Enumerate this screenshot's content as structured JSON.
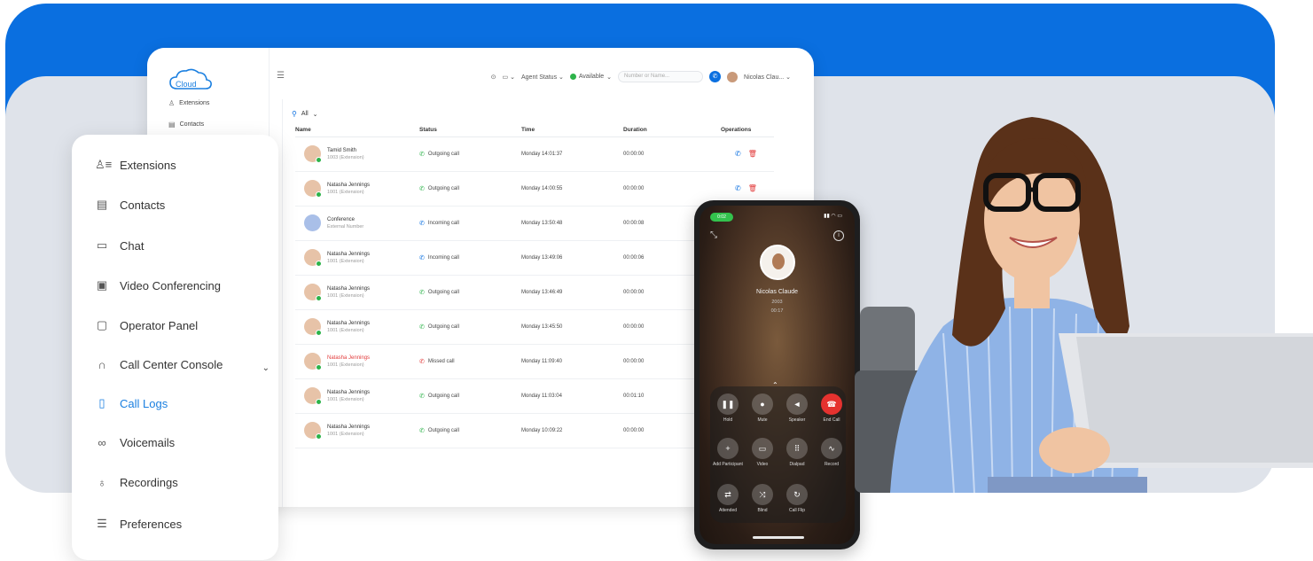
{
  "window": {
    "logo_text": "Cloud",
    "mini_nav": [
      "Extensions",
      "Contacts"
    ],
    "top_bar": {
      "agent_status": "Agent Status",
      "available": "Available",
      "search_placeholder": "Number or Name...",
      "user_name": "Nicolas Clau..."
    },
    "filter_label": "All",
    "table": {
      "headers": [
        "Name",
        "Status",
        "Time",
        "Duration",
        "Operations"
      ],
      "rows": [
        {
          "name": "Tamid Smith",
          "ext": "1003 (Extension)",
          "status": "Outgoing call",
          "status_type": "out",
          "time": "Monday 14:01:37",
          "duration": "00:00:00",
          "ops": true
        },
        {
          "name": "Natasha Jennings",
          "ext": "1001 (Extension)",
          "status": "Outgoing call",
          "status_type": "out",
          "time": "Monday 14:00:55",
          "duration": "00:00:00",
          "ops": true
        },
        {
          "name": "Conference",
          "ext": "External Number",
          "status": "Incoming call",
          "status_type": "in",
          "time": "Monday 13:50:48",
          "duration": "00:00:08",
          "ops": false
        },
        {
          "name": "Natasha Jennings",
          "ext": "1001 (Extension)",
          "status": "Incoming call",
          "status_type": "in",
          "time": "Monday 13:49:06",
          "duration": "00:00:06",
          "ops": false
        },
        {
          "name": "Natasha Jennings",
          "ext": "1001 (Extension)",
          "status": "Outgoing call",
          "status_type": "out",
          "time": "Monday 13:46:49",
          "duration": "00:00:00",
          "ops": false
        },
        {
          "name": "Natasha Jennings",
          "ext": "1001 (Extension)",
          "status": "Outgoing call",
          "status_type": "out",
          "time": "Monday 13:45:50",
          "duration": "00:00:00",
          "ops": false
        },
        {
          "name": "Natasha Jennings",
          "ext": "1001 (Extension)",
          "status": "Missed call",
          "status_type": "miss",
          "time": "Monday 11:09:40",
          "duration": "00:00:00",
          "ops": false
        },
        {
          "name": "Natasha Jennings",
          "ext": "1001 (Extension)",
          "status": "Outgoing call",
          "status_type": "out",
          "time": "Monday 11:03:04",
          "duration": "00:01:10",
          "ops": false
        },
        {
          "name": "Natasha Jennings",
          "ext": "1001 (Extension)",
          "status": "Outgoing call",
          "status_type": "out",
          "time": "Monday 10:09:22",
          "duration": "00:00:00",
          "ops": false
        }
      ]
    }
  },
  "sidebar": {
    "items": [
      {
        "label": "Extensions",
        "icon": "extensions-icon",
        "glyph": "♙≡"
      },
      {
        "label": "Contacts",
        "icon": "contacts-icon",
        "glyph": "▤"
      },
      {
        "label": "Chat",
        "icon": "chat-icon",
        "glyph": "▭"
      },
      {
        "label": "Video Conferencing",
        "icon": "video-conferencing-icon",
        "glyph": "▣"
      },
      {
        "label": "Operator Panel",
        "icon": "operator-panel-icon",
        "glyph": "▢"
      },
      {
        "label": "Call Center Console",
        "icon": "headset-icon",
        "glyph": "∩"
      },
      {
        "label": "Call Logs",
        "icon": "call-logs-icon",
        "glyph": "▯"
      },
      {
        "label": "Voicemails",
        "icon": "voicemail-icon",
        "glyph": "∞"
      },
      {
        "label": "Recordings",
        "icon": "microphone-icon",
        "glyph": "♁"
      },
      {
        "label": "Preferences",
        "icon": "preferences-icon",
        "glyph": "☰"
      }
    ],
    "active": "Call Logs"
  },
  "phone": {
    "status_pill": "0:02",
    "caller_name": "Nicolas Claude",
    "caller_ext": "2003",
    "call_timer": "00:17",
    "controls": [
      {
        "label": "Hold",
        "icon": "pause-icon",
        "glyph": "❚❚"
      },
      {
        "label": "Mute",
        "icon": "microphone-icon",
        "glyph": "●"
      },
      {
        "label": "Speaker",
        "icon": "speaker-off-icon",
        "glyph": "◄"
      },
      {
        "label": "End Call",
        "icon": "end-call-icon",
        "glyph": "☎"
      },
      {
        "label": "Add Participant",
        "icon": "add-participant-icon",
        "glyph": "+"
      },
      {
        "label": "Video",
        "icon": "video-off-icon",
        "glyph": "▭"
      },
      {
        "label": "Dialpad",
        "icon": "dialpad-icon",
        "glyph": "⠿"
      },
      {
        "label": "Record",
        "icon": "record-icon",
        "glyph": "∿"
      },
      {
        "label": "Attended",
        "icon": "attended-transfer-icon",
        "glyph": "⇄"
      },
      {
        "label": "Blind",
        "icon": "blind-transfer-icon",
        "glyph": "⤨"
      },
      {
        "label": "Call Flip",
        "icon": "call-flip-icon",
        "glyph": "↻"
      }
    ]
  },
  "colors": {
    "brand_blue": "#0a6fe0",
    "active_nav": "#1a7fe0",
    "green": "#2db34a",
    "red": "#e5322f"
  }
}
